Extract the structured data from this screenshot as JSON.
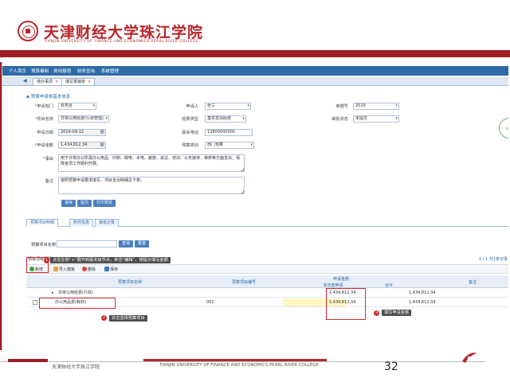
{
  "header": {
    "school_cn": "天津财经大学珠江学院",
    "school_en": "TIANJIN UNIVERSITY OF FINANCE AND ECONOMICS PEARL RIVER COLLEGE"
  },
  "menu": [
    "个人首页",
    "预算编制",
    "费用报销",
    "财务查询",
    "系统管理"
  ],
  "tabs": [
    {
      "label": "待办事项"
    },
    {
      "label": "填写报销单"
    }
  ],
  "section_title": "预算申请单基本信息",
  "form": {
    "dept_label": "申请部门",
    "dept_value": "财务处",
    "applicant_label": "申请人",
    "applicant_value": "张三",
    "doc_no_label": "单据号",
    "doc_no_value": "2019",
    "project_label": "项目名称",
    "project_value": "日常公用经费(行政管理)",
    "type_label": "经费类型",
    "type_value": "基本支出经费",
    "status_label": "审批状态",
    "status_value": "未提交",
    "date_label": "申请日期",
    "date_value": "2019-09-12",
    "phone_label": "联系电话",
    "phone_value": "13800000000",
    "amount_label": "申请金额",
    "amount_value": "1,434,812.34",
    "budget_label": "预算类别",
    "budget_value": "部门预算",
    "reason_label": "事由",
    "reason_value": "用于日常办公所需办公用品、印刷、邮电、水电、差旅、会议、培训、公务接待、维修等方面支出，保障各项工作顺利开展。",
    "remark_label": "备注",
    "remark_value": "按照预算申请要求填写，项目支出明细见下表。"
  },
  "form_buttons": [
    "保存",
    "提交",
    "打印预览"
  ],
  "stamp": "审核",
  "subtabs": [
    "预算项目明细",
    "附件信息",
    "审批记录"
  ],
  "filter": {
    "label": "预算项目名称:",
    "query": "查询",
    "reset": "重置"
  },
  "grid": {
    "left_title": "预算项目明细",
    "right_link": "1 / 1  共1条记录"
  },
  "toolbar": {
    "add": "新增",
    "import": "导入模板",
    "delete": "删除",
    "save": "保存"
  },
  "columns": {
    "name": "预算项目名称",
    "code": "预算项目编号",
    "amount_group": "申请金额",
    "amount_a": "本年度申请",
    "amount_b": "合计",
    "remark": "备注"
  },
  "rows": [
    {
      "name": "日常公用经费(行政)",
      "code": "",
      "amount_a": "1,434,812.34",
      "amount_b": "1,434,812.34"
    },
    {
      "name": "办公用品费(耗材)",
      "code": "001",
      "amount_a": "1,434,812.34",
      "amount_b": "1,434,812.34"
    }
  ],
  "callouts": {
    "top": "点击左侧“+”展开到最末级节点，单击“编辑”，按提示填写金额",
    "bottom_left": "双击选择预算项目",
    "bottom_right": "填写申请金额"
  },
  "footer": {
    "cn": "天津财经大学珠江学院",
    "en": "TIANJIN UNIVERSITY OF FINANCE AND ECONOMICS PEARL RIVER COLLEGE",
    "page": "32"
  },
  "colors": {
    "brand_red": "#9e1f24",
    "nav_blue": "#2d6aa8",
    "annotation_red": "#d42a2a"
  }
}
